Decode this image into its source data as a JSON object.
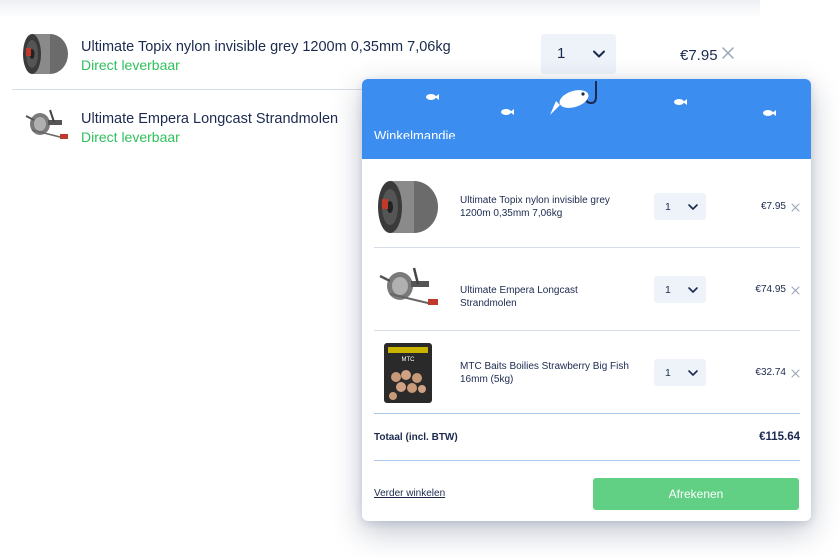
{
  "background_list": {
    "items": [
      {
        "name": "Ultimate Topix nylon invisible grey 1200m 0,35mm 7,06kg",
        "stock": "Direct leverbaar",
        "qty": "1",
        "price": "€7.95",
        "thumb_icon": "fishing-line-spool-icon"
      },
      {
        "name": "Ultimate Empera Longcast Strandmolen",
        "stock": "Direct leverbaar",
        "thumb_icon": "fishing-reel-icon"
      }
    ]
  },
  "cart": {
    "title": "Winkelmandje",
    "header_color": "#3b8ef0",
    "items": [
      {
        "name": "Ultimate Topix nylon invisible grey 1200m 0,35mm 7,06kg",
        "qty": "1",
        "price": "€7.95",
        "thumb_icon": "fishing-line-spool-icon"
      },
      {
        "name": "Ultimate Empera Longcast Strandmolen",
        "qty": "1",
        "price": "€74.95",
        "thumb_icon": "fishing-reel-icon"
      },
      {
        "name": "MTC Baits Boilies Strawberry Big Fish 16mm (5kg)",
        "qty": "1",
        "price": "€32.74",
        "thumb_icon": "boilies-bag-icon"
      }
    ],
    "total_label": "Totaal (incl. BTW)",
    "total_value": "€115.64",
    "continue_label": "Verder winkelen",
    "checkout_label": "Afrekenen",
    "checkout_color": "#61cf84"
  },
  "colors": {
    "text": "#1b2a4e",
    "stock_green": "#2fbf5c"
  }
}
